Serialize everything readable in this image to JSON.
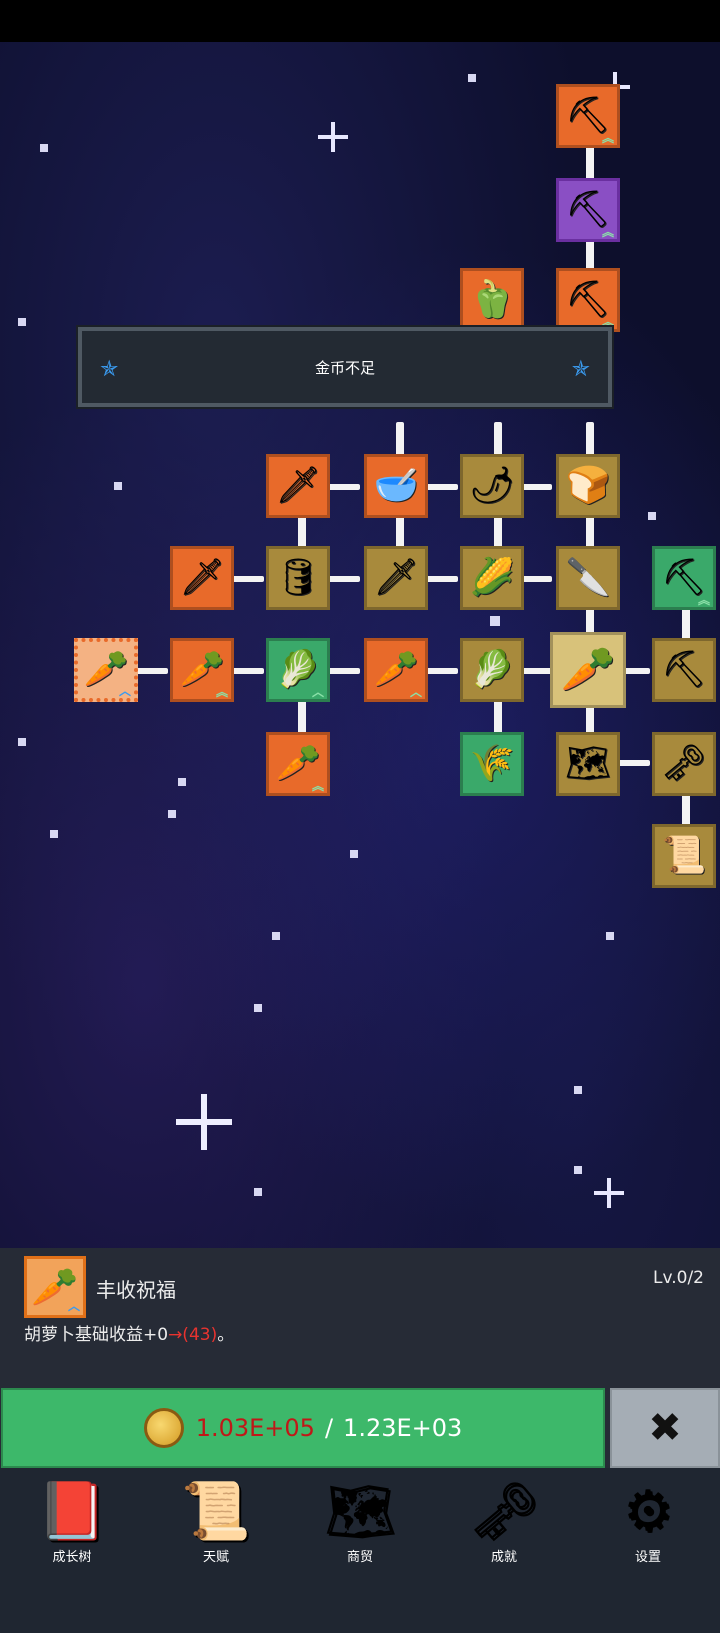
{
  "toast": {
    "message": "金币不足"
  },
  "tree": {
    "nodes": [
      {
        "id": "shovel-top",
        "icon": "shovel-icon",
        "glyph": "⛏",
        "color": "orange",
        "upgrade": true
      },
      {
        "id": "shovel-purple",
        "icon": "shovel-icon",
        "glyph": "⛏",
        "color": "purple",
        "upgrade": true
      },
      {
        "id": "pepper",
        "icon": "bell-pepper-icon",
        "glyph": "🫑",
        "color": "orange",
        "upgrade": false
      },
      {
        "id": "shovel-3",
        "icon": "shovel-icon",
        "glyph": "⛏",
        "color": "orange",
        "upgrade": true
      },
      {
        "id": "sword-gold",
        "icon": "golden-sword-icon",
        "glyph": "🗡",
        "color": "orange",
        "upgrade": false
      },
      {
        "id": "bowl",
        "icon": "wooden-bowl-icon",
        "glyph": "🥣",
        "color": "orange",
        "upgrade": false
      },
      {
        "id": "chili",
        "icon": "chili-pepper-icon",
        "glyph": "🌶",
        "color": "gold",
        "upgrade": false
      },
      {
        "id": "bread",
        "icon": "bread-loaf-icon",
        "glyph": "🍞",
        "color": "gold",
        "upgrade": false
      },
      {
        "id": "sword-iron",
        "icon": "sword-icon",
        "glyph": "🗡",
        "color": "orange",
        "upgrade": false
      },
      {
        "id": "barrel",
        "icon": "barrel-icon",
        "glyph": "🛢",
        "color": "gold",
        "upgrade": false
      },
      {
        "id": "sword-2",
        "icon": "sword-icon",
        "glyph": "🗡",
        "color": "gold",
        "upgrade": false
      },
      {
        "id": "corn",
        "icon": "corn-icon",
        "glyph": "🌽",
        "color": "gold",
        "upgrade": false
      },
      {
        "id": "knife",
        "icon": "knife-icon",
        "glyph": "🔪",
        "color": "gold",
        "upgrade": false
      },
      {
        "id": "pickaxe-green",
        "icon": "pickaxe-icon",
        "glyph": "⛏",
        "color": "green",
        "upgrade": true
      },
      {
        "id": "carrot-selected",
        "icon": "carrot-icon",
        "glyph": "🥕",
        "color": "selected",
        "upgrade": true
      },
      {
        "id": "carrot-2",
        "icon": "carrot-icon",
        "glyph": "🥕",
        "color": "orange",
        "upgrade": true
      },
      {
        "id": "cabbage-1",
        "icon": "cabbage-icon",
        "glyph": "🥬",
        "color": "green",
        "upgrade": true
      },
      {
        "id": "carrot-3",
        "icon": "carrot-icon",
        "glyph": "🥕",
        "color": "orange",
        "upgrade": true
      },
      {
        "id": "cabbage-2",
        "icon": "cabbage-icon",
        "glyph": "🥬",
        "color": "gold",
        "upgrade": false
      },
      {
        "id": "carrot-big",
        "icon": "carrot-icon",
        "glyph": "🥕",
        "color": "tan",
        "upgrade": false
      },
      {
        "id": "pickaxe-gold",
        "icon": "pickaxe-icon",
        "glyph": "⛏",
        "color": "gold",
        "upgrade": false
      },
      {
        "id": "carrot-4",
        "icon": "carrot-icon",
        "glyph": "🥕",
        "color": "orange",
        "upgrade": true
      },
      {
        "id": "hay",
        "icon": "wheat-sheaf-icon",
        "glyph": "🌾",
        "color": "green",
        "upgrade": false
      },
      {
        "id": "map",
        "icon": "map-icon",
        "glyph": "🗺",
        "color": "gold",
        "upgrade": false
      },
      {
        "id": "key",
        "icon": "key-icon",
        "glyph": "🗝",
        "color": "gold",
        "upgrade": false
      },
      {
        "id": "scroll",
        "icon": "scroll-icon",
        "glyph": "📜",
        "color": "gold",
        "upgrade": false
      }
    ]
  },
  "detail": {
    "icon": "carrot-icon",
    "glyph": "🥕",
    "name": "丰收祝福",
    "level": "Lv.0/2",
    "desc_prefix": "胡萝卜基础收益+0",
    "desc_arrow": "→(43)",
    "desc_suffix": "。"
  },
  "buy": {
    "have": "1.03E+05",
    "separator": "/",
    "cost": "1.23E+03",
    "close_label": "✖"
  },
  "nav": [
    {
      "label": "成长树",
      "icon": "book-icon",
      "glyph": "📕"
    },
    {
      "label": "天赋",
      "icon": "scroll-icon",
      "glyph": "📜"
    },
    {
      "label": "商贸",
      "icon": "map-icon",
      "glyph": "🗺"
    },
    {
      "label": "成就",
      "icon": "key-icon",
      "glyph": "🗝"
    },
    {
      "label": "设置",
      "icon": "gear-icon",
      "glyph": "⚙"
    }
  ]
}
